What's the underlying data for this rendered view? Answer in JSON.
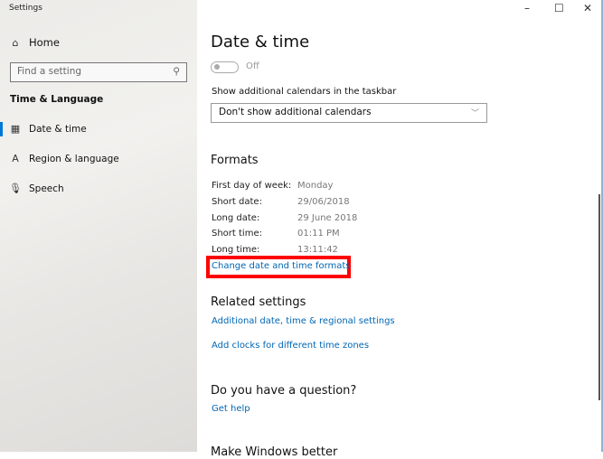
{
  "window": {
    "title": "Settings",
    "minimize": "–",
    "maximize": "☐",
    "close": "✕"
  },
  "sidebar": {
    "home": "Home",
    "search_placeholder": "Find a setting",
    "group": "Time & Language",
    "items": [
      {
        "label": "Date & time",
        "icon": "calendar-clock-icon"
      },
      {
        "label": "Region & language",
        "icon": "language-icon"
      },
      {
        "label": "Speech",
        "icon": "microphone-icon"
      }
    ]
  },
  "main": {
    "title": "Date & time",
    "toggle_state": "Off",
    "calendars_label": "Show additional calendars in the taskbar",
    "calendars_value": "Don't show additional calendars",
    "formats_heading": "Formats",
    "formats": [
      {
        "k": "First day of week:",
        "v": "Monday"
      },
      {
        "k": "Short date:",
        "v": "29/06/2018"
      },
      {
        "k": "Long date:",
        "v": "29 June 2018"
      },
      {
        "k": "Short time:",
        "v": "01:11 PM"
      },
      {
        "k": "Long time:",
        "v": "13:11:42"
      }
    ],
    "change_formats": "Change date and time formats",
    "related_heading": "Related settings",
    "related": [
      "Additional date, time & regional settings",
      "Add clocks for different time zones"
    ],
    "question_heading": "Do you have a question?",
    "get_help": "Get help",
    "partial_heading": "Make Windows better"
  }
}
